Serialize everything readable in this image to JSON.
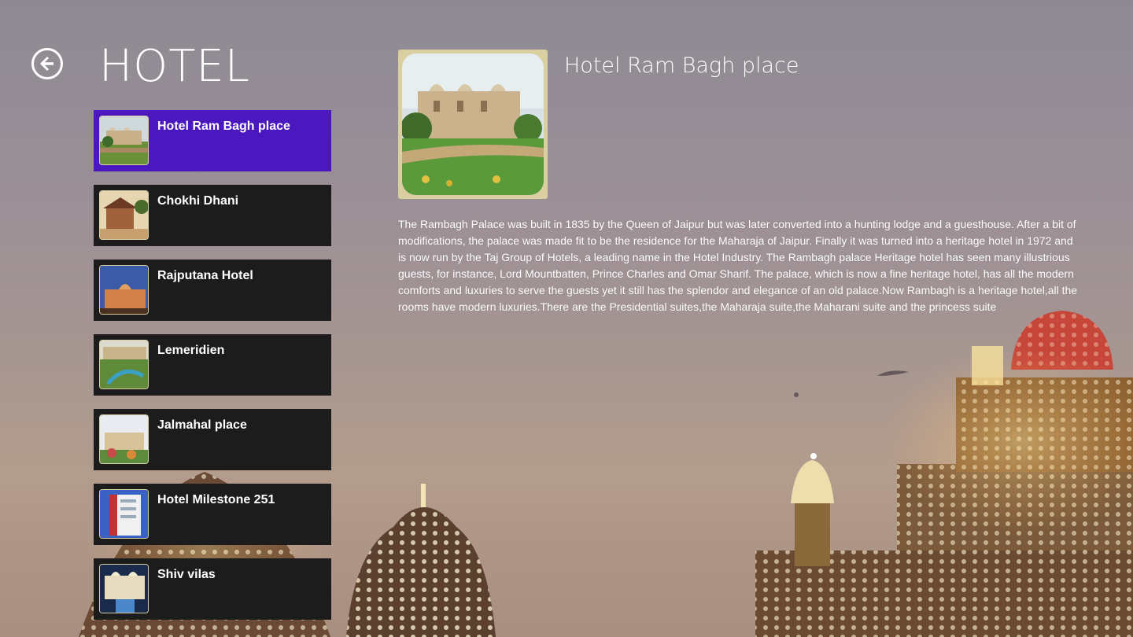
{
  "page": {
    "title": "HOTEL",
    "back_icon": "back-arrow-icon"
  },
  "hotels": [
    {
      "name": "Hotel Ram Bagh place",
      "selected": true
    },
    {
      "name": "Chokhi Dhani",
      "selected": false
    },
    {
      "name": "Rajputana Hotel",
      "selected": false
    },
    {
      "name": "Lemeridien",
      "selected": false
    },
    {
      "name": "Jalmahal place",
      "selected": false
    },
    {
      "name": "Hotel Milestone 251",
      "selected": false
    },
    {
      "name": "Shiv vilas",
      "selected": false
    }
  ],
  "detail": {
    "title": "Hotel Ram Bagh place",
    "description": "The Rambagh Palace was built in 1835 by the Queen of Jaipur but was later converted into a hunting lodge and a guesthouse. After a bit of modifications, the palace was made fit to be the residence for the Maharaja of Jaipur. Finally it was turned into a heritage hotel in 1972 and is now run by the Taj Group of Hotels, a leading name in the Hotel Industry. The Rambagh palace Heritage hotel has seen many illustrious guests, for instance, Lord Mountbatten, Prince Charles and Omar Sharif. The palace, which is now a fine heritage hotel, has all the modern comforts and luxuries to serve the guests yet it still has the splendor and elegance of an old palace.Now Rambagh is a heritage hotel,all the rooms have modern luxuries.There are the Presidential suites,the Maharaja suite,the Maharani suite and the princess suite"
  },
  "colors": {
    "selected": "#4b17bf",
    "item_bg": "#1c1c1c",
    "text": "#ffffff"
  }
}
